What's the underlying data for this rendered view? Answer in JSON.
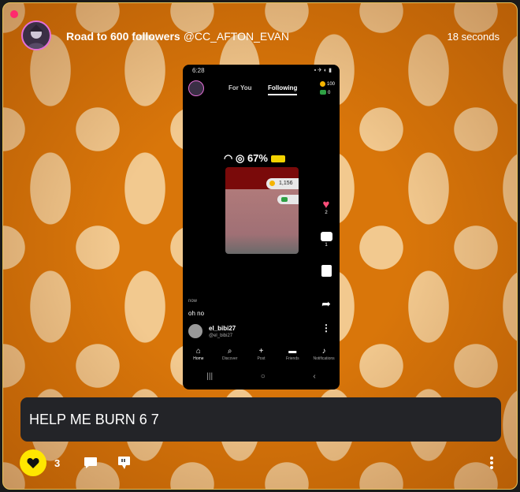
{
  "post": {
    "title": "Road to 600 followers",
    "user": "@CC_AFTON_EVAN",
    "time": "18 seconds",
    "comment": "HELP ME BURN 6 7",
    "like_count": "3"
  },
  "phone": {
    "time": "6:28",
    "tabs": [
      "For You",
      "Following"
    ],
    "active_tab": "Following",
    "coins": "100",
    "cash": "0",
    "inner_status": "67%",
    "inner_coins": "1,156",
    "side": {
      "likes": "2",
      "comments": "1"
    },
    "now_label": "now",
    "caption": "oh no",
    "user_name": "el_bibi27",
    "user_handle": "@el_bibi27",
    "nav": [
      "Home",
      "Discover",
      "Post",
      "Friends",
      "Notifications"
    ]
  },
  "colors": {
    "accent": "#ffe600",
    "background": "#d9760a",
    "notif": "#ff2a6d",
    "heart": "#ff4d79"
  },
  "icons": [
    "heart-icon",
    "comment-icon",
    "dislike-icon",
    "more-icon",
    "share-icon"
  ]
}
